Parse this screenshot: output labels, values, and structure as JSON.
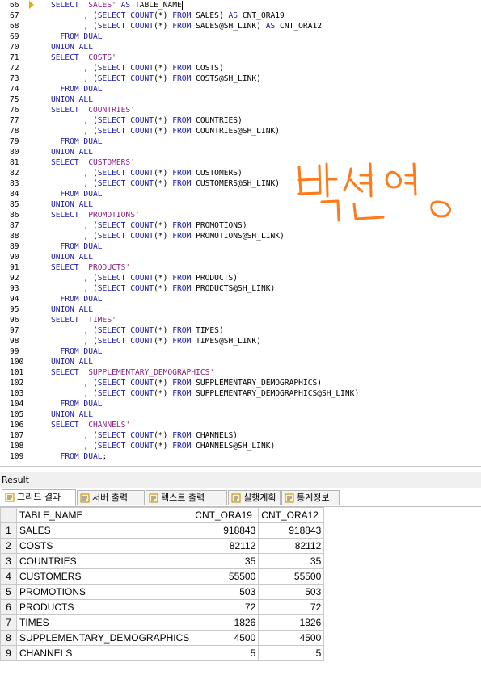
{
  "editor": {
    "lines": [
      {
        "n": "66",
        "segs": [
          [
            "kw",
            "SELECT "
          ],
          [
            "str",
            "'SALES'"
          ],
          [
            "kw",
            " AS "
          ],
          [
            "id",
            "TABLE_NAME"
          ]
        ],
        "arrow": true,
        "cursor": true
      },
      {
        "n": "67",
        "segs": [
          [
            "id",
            "       , ("
          ],
          [
            "kw",
            "SELECT COUNT"
          ],
          [
            "id",
            "(*) "
          ],
          [
            "kw",
            "FROM "
          ],
          [
            "id",
            "SALES) "
          ],
          [
            "kw",
            "AS "
          ],
          [
            "id",
            "CNT_ORA19"
          ]
        ]
      },
      {
        "n": "68",
        "segs": [
          [
            "id",
            "       , ("
          ],
          [
            "kw",
            "SELECT COUNT"
          ],
          [
            "id",
            "(*) "
          ],
          [
            "kw",
            "FROM "
          ],
          [
            "id",
            "SALES@SH_LINK) "
          ],
          [
            "kw",
            "AS "
          ],
          [
            "id",
            "CNT_ORA12"
          ]
        ]
      },
      {
        "n": "69",
        "segs": [
          [
            "kw",
            "  FROM DUAL"
          ]
        ]
      },
      {
        "n": "70",
        "segs": [
          [
            "kw",
            "UNION ALL"
          ]
        ]
      },
      {
        "n": "71",
        "segs": [
          [
            "kw",
            "SELECT "
          ],
          [
            "str",
            "'COSTS'"
          ]
        ]
      },
      {
        "n": "72",
        "segs": [
          [
            "id",
            "       , ("
          ],
          [
            "kw",
            "SELECT COUNT"
          ],
          [
            "id",
            "(*) "
          ],
          [
            "kw",
            "FROM "
          ],
          [
            "id",
            "COSTS)"
          ]
        ]
      },
      {
        "n": "73",
        "segs": [
          [
            "id",
            "       , ("
          ],
          [
            "kw",
            "SELECT COUNT"
          ],
          [
            "id",
            "(*) "
          ],
          [
            "kw",
            "FROM "
          ],
          [
            "id",
            "COSTS@SH_LINK)"
          ]
        ]
      },
      {
        "n": "74",
        "segs": [
          [
            "kw",
            "  FROM DUAL"
          ]
        ]
      },
      {
        "n": "75",
        "segs": [
          [
            "kw",
            "UNION ALL"
          ]
        ]
      },
      {
        "n": "76",
        "segs": [
          [
            "kw",
            "SELECT "
          ],
          [
            "str",
            "'COUNTRIES'"
          ]
        ]
      },
      {
        "n": "77",
        "segs": [
          [
            "id",
            "       , ("
          ],
          [
            "kw",
            "SELECT COUNT"
          ],
          [
            "id",
            "(*) "
          ],
          [
            "kw",
            "FROM "
          ],
          [
            "id",
            "COUNTRIES)"
          ]
        ]
      },
      {
        "n": "78",
        "segs": [
          [
            "id",
            "       , ("
          ],
          [
            "kw",
            "SELECT COUNT"
          ],
          [
            "id",
            "(*) "
          ],
          [
            "kw",
            "FROM "
          ],
          [
            "id",
            "COUNTRIES@SH_LINK)"
          ]
        ]
      },
      {
        "n": "79",
        "segs": [
          [
            "kw",
            "  FROM DUAL"
          ]
        ]
      },
      {
        "n": "80",
        "segs": [
          [
            "kw",
            "UNION ALL"
          ]
        ]
      },
      {
        "n": "81",
        "segs": [
          [
            "kw",
            "SELECT "
          ],
          [
            "str",
            "'CUSTOMERS'"
          ]
        ]
      },
      {
        "n": "82",
        "segs": [
          [
            "id",
            "       , ("
          ],
          [
            "kw",
            "SELECT COUNT"
          ],
          [
            "id",
            "(*) "
          ],
          [
            "kw",
            "FROM "
          ],
          [
            "id",
            "CUSTOMERS)"
          ]
        ]
      },
      {
        "n": "83",
        "segs": [
          [
            "id",
            "       , ("
          ],
          [
            "kw",
            "SELECT COUNT"
          ],
          [
            "id",
            "(*) "
          ],
          [
            "kw",
            "FROM "
          ],
          [
            "id",
            "CUSTOMERS@SH_LINK)"
          ]
        ]
      },
      {
        "n": "84",
        "segs": [
          [
            "kw",
            "  FROM DUAL"
          ]
        ]
      },
      {
        "n": "85",
        "segs": [
          [
            "kw",
            "UNION ALL"
          ]
        ]
      },
      {
        "n": "86",
        "segs": [
          [
            "kw",
            "SELECT "
          ],
          [
            "str",
            "'PROMOTIONS'"
          ]
        ]
      },
      {
        "n": "87",
        "segs": [
          [
            "id",
            "       , ("
          ],
          [
            "kw",
            "SELECT COUNT"
          ],
          [
            "id",
            "(*) "
          ],
          [
            "kw",
            "FROM "
          ],
          [
            "id",
            "PROMOTIONS)"
          ]
        ]
      },
      {
        "n": "88",
        "segs": [
          [
            "id",
            "       , ("
          ],
          [
            "kw",
            "SELECT COUNT"
          ],
          [
            "id",
            "(*) "
          ],
          [
            "kw",
            "FROM "
          ],
          [
            "id",
            "PROMOTIONS@SH_LINK)"
          ]
        ]
      },
      {
        "n": "89",
        "segs": [
          [
            "kw",
            "  FROM DUAL"
          ]
        ]
      },
      {
        "n": "90",
        "segs": [
          [
            "kw",
            "UNION ALL"
          ]
        ]
      },
      {
        "n": "91",
        "segs": [
          [
            "kw",
            "SELECT "
          ],
          [
            "str",
            "'PRODUCTS'"
          ]
        ]
      },
      {
        "n": "92",
        "segs": [
          [
            "id",
            "       , ("
          ],
          [
            "kw",
            "SELECT COUNT"
          ],
          [
            "id",
            "(*) "
          ],
          [
            "kw",
            "FROM "
          ],
          [
            "id",
            "PRODUCTS)"
          ]
        ]
      },
      {
        "n": "93",
        "segs": [
          [
            "id",
            "       , ("
          ],
          [
            "kw",
            "SELECT COUNT"
          ],
          [
            "id",
            "(*) "
          ],
          [
            "kw",
            "FROM "
          ],
          [
            "id",
            "PRODUCTS@SH_LINK)"
          ]
        ]
      },
      {
        "n": "94",
        "segs": [
          [
            "kw",
            "  FROM DUAL"
          ]
        ]
      },
      {
        "n": "95",
        "segs": [
          [
            "kw",
            "UNION ALL"
          ]
        ]
      },
      {
        "n": "96",
        "segs": [
          [
            "kw",
            "SELECT "
          ],
          [
            "str",
            "'TIMES'"
          ]
        ]
      },
      {
        "n": "97",
        "segs": [
          [
            "id",
            "       , ("
          ],
          [
            "kw",
            "SELECT COUNT"
          ],
          [
            "id",
            "(*) "
          ],
          [
            "kw",
            "FROM "
          ],
          [
            "id",
            "TIMES)"
          ]
        ]
      },
      {
        "n": "98",
        "segs": [
          [
            "id",
            "       , ("
          ],
          [
            "kw",
            "SELECT COUNT"
          ],
          [
            "id",
            "(*) "
          ],
          [
            "kw",
            "FROM "
          ],
          [
            "id",
            "TIMES@SH_LINK)"
          ]
        ]
      },
      {
        "n": "99",
        "segs": [
          [
            "kw",
            "  FROM DUAL"
          ]
        ]
      },
      {
        "n": "100",
        "segs": [
          [
            "kw",
            "UNION ALL"
          ]
        ]
      },
      {
        "n": "101",
        "segs": [
          [
            "kw",
            "SELECT "
          ],
          [
            "str",
            "'SUPPLEMENTARY_DEMOGRAPHICS'"
          ]
        ]
      },
      {
        "n": "102",
        "segs": [
          [
            "id",
            "       , ("
          ],
          [
            "kw",
            "SELECT COUNT"
          ],
          [
            "id",
            "(*) "
          ],
          [
            "kw",
            "FROM "
          ],
          [
            "id",
            "SUPPLEMENTARY_DEMOGRAPHICS)"
          ]
        ]
      },
      {
        "n": "103",
        "segs": [
          [
            "id",
            "       , ("
          ],
          [
            "kw",
            "SELECT COUNT"
          ],
          [
            "id",
            "(*) "
          ],
          [
            "kw",
            "FROM "
          ],
          [
            "id",
            "SUPPLEMENTARY_DEMOGRAPHICS@SH_LINK)"
          ]
        ]
      },
      {
        "n": "104",
        "segs": [
          [
            "kw",
            "  FROM DUAL"
          ]
        ]
      },
      {
        "n": "105",
        "segs": [
          [
            "kw",
            "UNION ALL"
          ]
        ]
      },
      {
        "n": "106",
        "segs": [
          [
            "kw",
            "SELECT "
          ],
          [
            "str",
            "'CHANNELS'"
          ]
        ]
      },
      {
        "n": "107",
        "segs": [
          [
            "id",
            "       , ("
          ],
          [
            "kw",
            "SELECT COUNT"
          ],
          [
            "id",
            "(*) "
          ],
          [
            "kw",
            "FROM "
          ],
          [
            "id",
            "CHANNELS)"
          ]
        ]
      },
      {
        "n": "108",
        "segs": [
          [
            "id",
            "       , ("
          ],
          [
            "kw",
            "SELECT COUNT"
          ],
          [
            "id",
            "(*) "
          ],
          [
            "kw",
            "FROM "
          ],
          [
            "id",
            "CHANNELS@SH_LINK)"
          ]
        ]
      },
      {
        "n": "109",
        "segs": [
          [
            "kw",
            "  FROM DUAL"
          ],
          [
            "id",
            ";"
          ]
        ]
      }
    ],
    "signature": "박선영",
    "colors": {
      "keyword": "#1a1aa6",
      "string": "#8a1f86",
      "signature": "#ff7a1a"
    }
  },
  "result": {
    "label": "Result",
    "tabs": [
      {
        "label": "그리드 결과",
        "icon": "grid-icon",
        "active": true
      },
      {
        "label": "서버 출력",
        "icon": "server-output-icon"
      },
      {
        "label": "텍스트 출력",
        "icon": "text-output-icon"
      },
      {
        "label": "실행계획",
        "icon": "execution-plan-icon"
      },
      {
        "label": "통계정보",
        "icon": "statistics-icon"
      }
    ],
    "columns": [
      "TABLE_NAME",
      "CNT_ORA19",
      "CNT_ORA12"
    ],
    "rows": [
      [
        "1",
        "SALES",
        "918843",
        "918843"
      ],
      [
        "2",
        "COSTS",
        "82112",
        "82112"
      ],
      [
        "3",
        "COUNTRIES",
        "35",
        "35"
      ],
      [
        "4",
        "CUSTOMERS",
        "55500",
        "55500"
      ],
      [
        "5",
        "PROMOTIONS",
        "503",
        "503"
      ],
      [
        "6",
        "PRODUCTS",
        "72",
        "72"
      ],
      [
        "7",
        "TIMES",
        "1826",
        "1826"
      ],
      [
        "8",
        "SUPPLEMENTARY_DEMOGRAPHICS",
        "4500",
        "4500"
      ],
      [
        "9",
        "CHANNELS",
        "5",
        "5"
      ]
    ]
  }
}
